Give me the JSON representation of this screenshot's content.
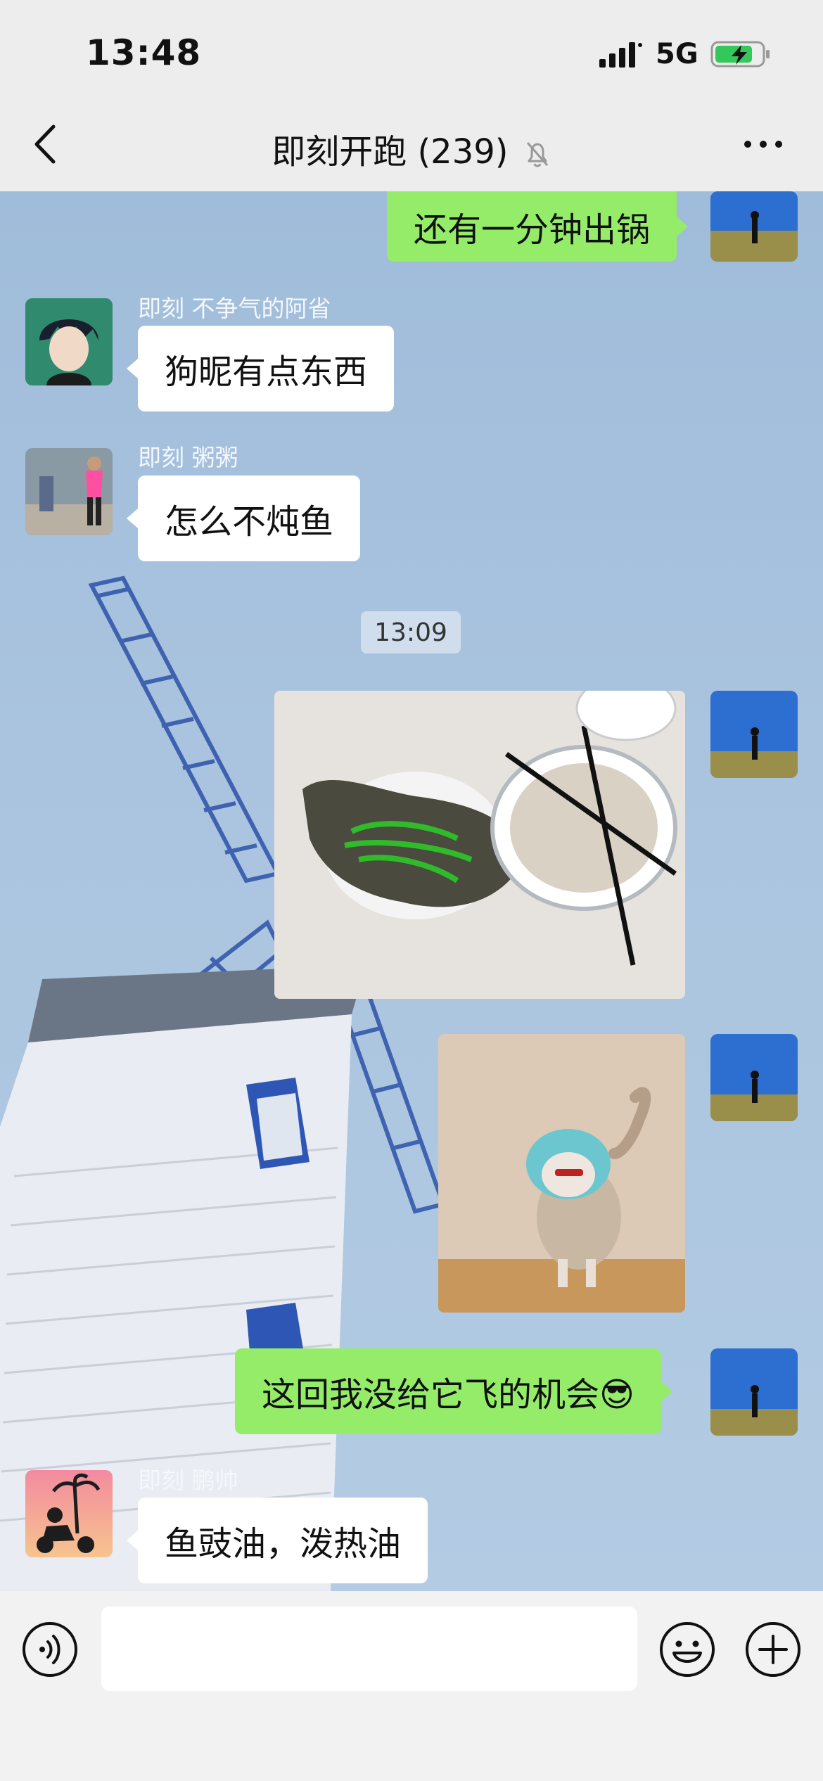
{
  "status_bar": {
    "time": "13:48",
    "network": "5G"
  },
  "nav": {
    "title": "即刻开跑 (239)"
  },
  "messages": [
    {
      "text": "还有一分钟出锅"
    },
    {
      "sender": "即刻 不争气的阿省",
      "text": "狗昵有点东西"
    },
    {
      "sender": "即刻 粥粥",
      "text": "怎么不炖鱼"
    },
    {
      "timestamp": "13:09"
    },
    {
      "image": "steamed-fish-photo"
    },
    {
      "image": "cat-gif"
    },
    {
      "text": "这回我没给它飞的机会😎"
    },
    {
      "sender": "即刻 鹏帅",
      "text": "鱼豉油，泼热油"
    }
  ],
  "input": {
    "placeholder": ""
  },
  "colors": {
    "outgoing_bubble": "#95ec69",
    "incoming_bubble": "#ffffff",
    "bar_bg": "#ededed"
  }
}
